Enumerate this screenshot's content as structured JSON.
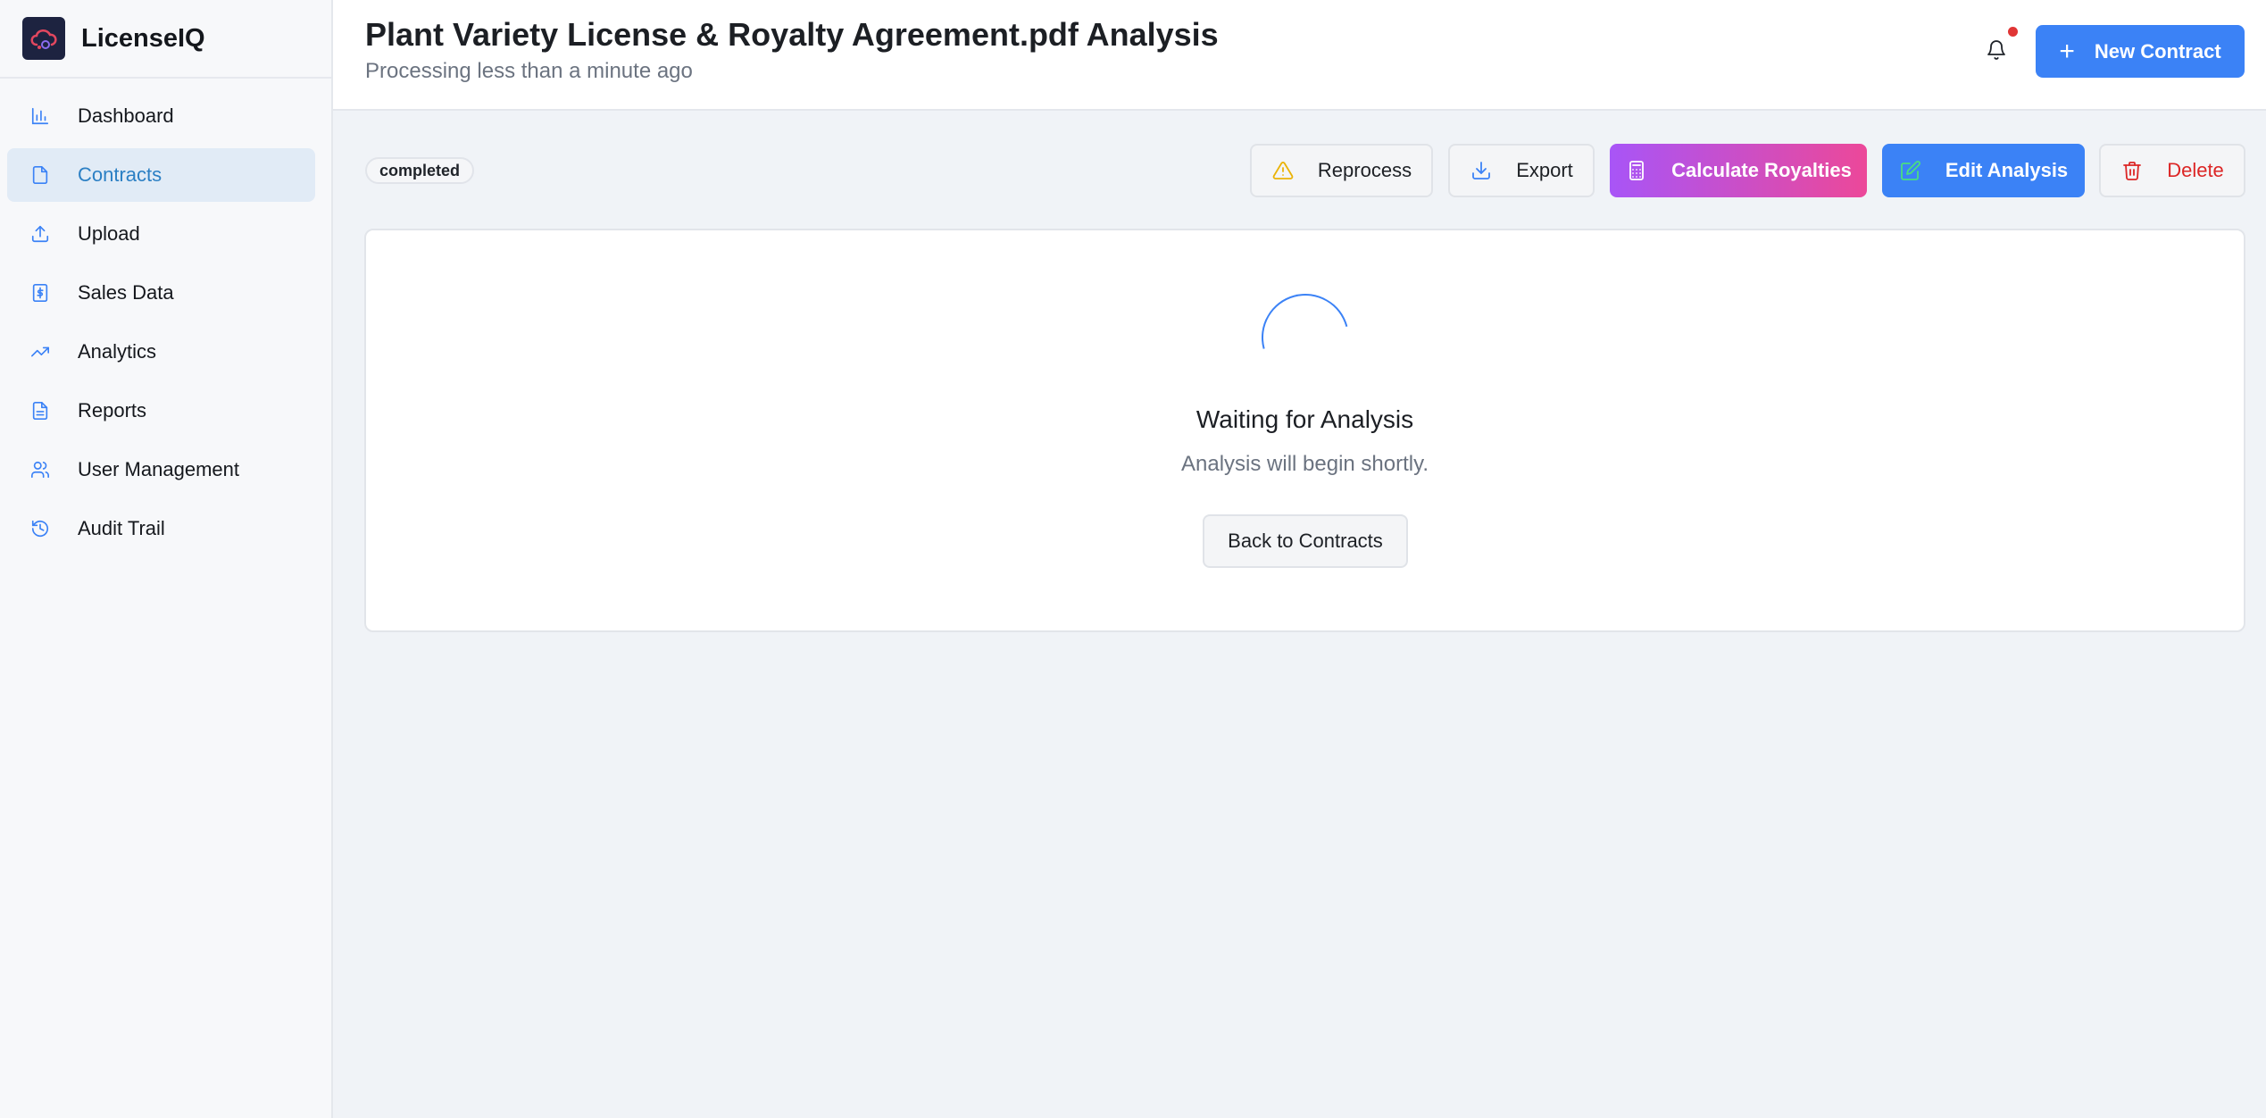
{
  "app": {
    "name": "LicenseIQ"
  },
  "sidebar": {
    "items": [
      {
        "label": "Dashboard",
        "icon": "bar-chart-icon",
        "active": false
      },
      {
        "label": "Contracts",
        "icon": "file-icon",
        "active": true
      },
      {
        "label": "Upload",
        "icon": "upload-icon",
        "active": false
      },
      {
        "label": "Sales Data",
        "icon": "dollar-file-icon",
        "active": false
      },
      {
        "label": "Analytics",
        "icon": "trending-up-icon",
        "active": false
      },
      {
        "label": "Reports",
        "icon": "file-text-icon",
        "active": false
      },
      {
        "label": "User Management",
        "icon": "users-icon",
        "active": false
      },
      {
        "label": "Audit Trail",
        "icon": "history-icon",
        "active": false
      }
    ]
  },
  "header": {
    "title": "Plant Variety License & Royalty Agreement.pdf Analysis",
    "subtitle": "Processing less than a minute ago",
    "new_contract_label": "New Contract",
    "has_notification": true
  },
  "toolbar": {
    "status": "completed",
    "reprocess_label": "Reprocess",
    "export_label": "Export",
    "calculate_label": "Calculate Royalties",
    "edit_label": "Edit Analysis",
    "delete_label": "Delete"
  },
  "main": {
    "title": "Waiting for Analysis",
    "subtitle": "Analysis will begin shortly.",
    "back_label": "Back to Contracts"
  },
  "colors": {
    "accent": "#3b82f6",
    "active_nav": "#2b7fc4",
    "danger": "#dc2626",
    "gradient_start": "#a855f7",
    "gradient_end": "#ec4899",
    "warning": "#eab308"
  }
}
